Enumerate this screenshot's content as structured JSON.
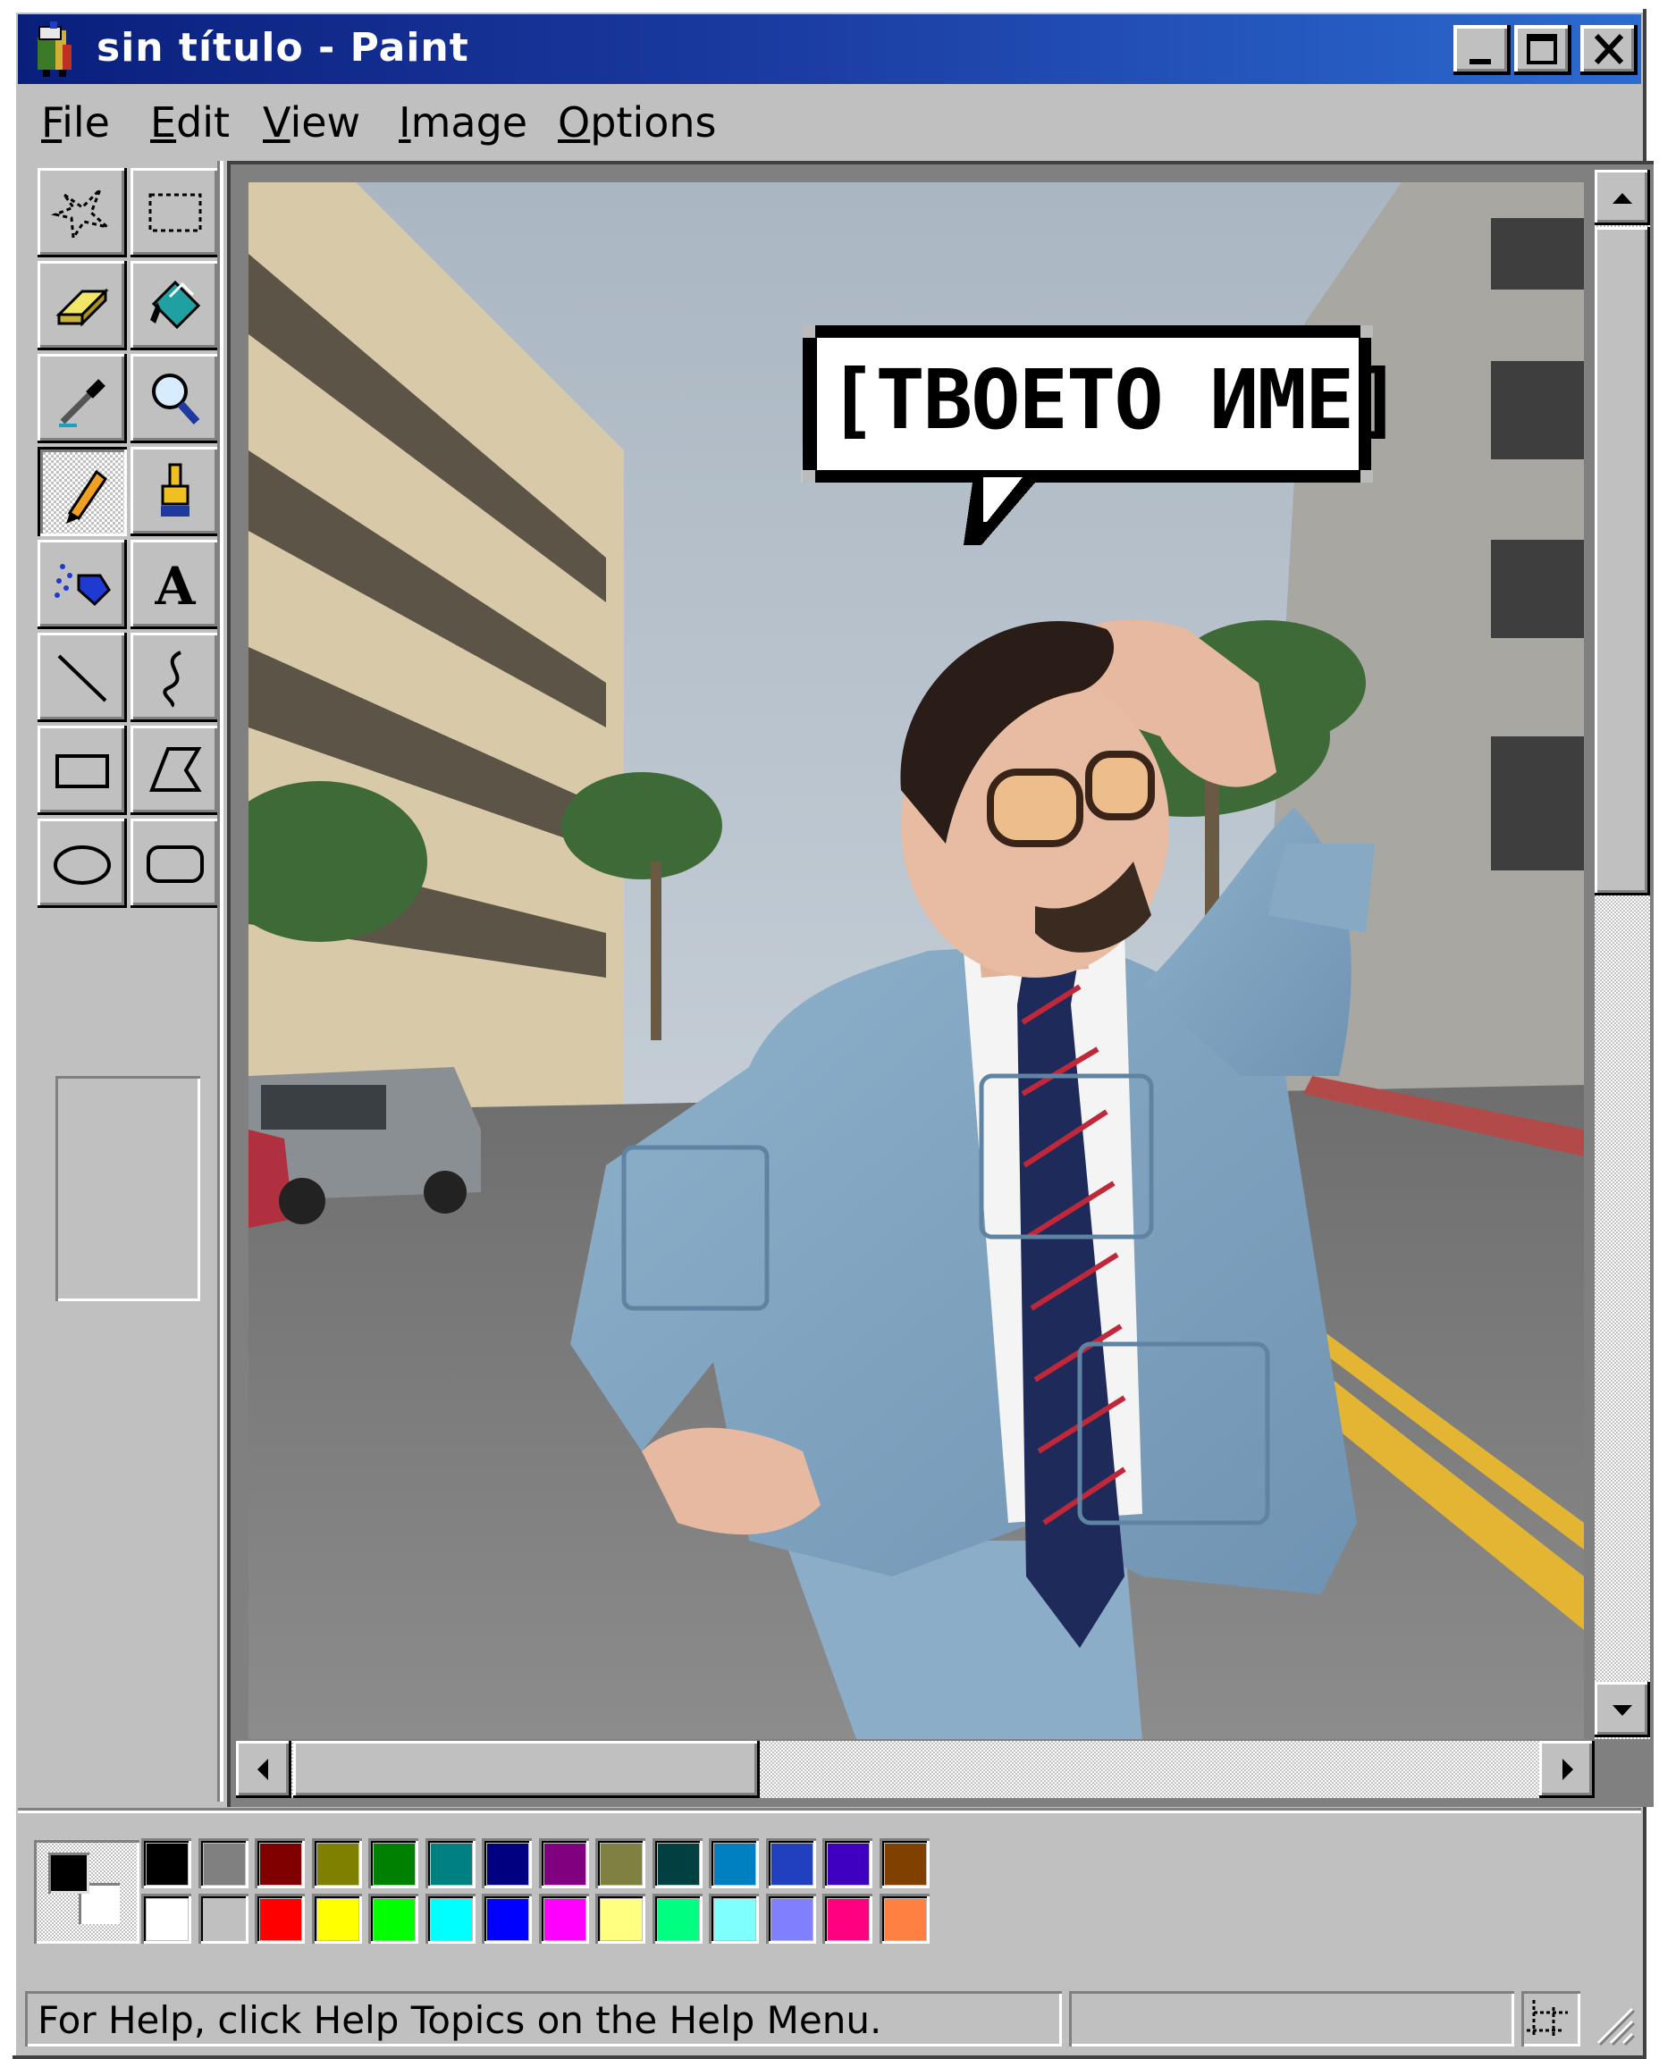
{
  "window": {
    "title": "sin título - Paint",
    "controls": [
      "minimize-icon",
      "maximize-icon",
      "close-icon"
    ]
  },
  "menu": {
    "items": [
      {
        "label": "File",
        "ul": "F",
        "rest": "ile"
      },
      {
        "label": "Edit",
        "ul": "E",
        "rest": "dit"
      },
      {
        "label": "View",
        "ul": "V",
        "rest": "iew"
      },
      {
        "label": "Image",
        "ul": "I",
        "rest": "mage"
      },
      {
        "label": "Options",
        "ul": "O",
        "rest": "ptions"
      }
    ]
  },
  "tools": [
    "free-form-select-icon",
    "rectangle-select-icon",
    "eraser-icon",
    "fill-bucket-icon",
    "color-picker-icon",
    "magnifier-icon",
    "pencil-icon",
    "brush-icon",
    "airbrush-icon",
    "text-icon",
    "line-icon",
    "curve-icon",
    "rectangle-icon",
    "polygon-icon",
    "ellipse-icon",
    "rounded-rectangle-icon"
  ],
  "active_tool": "pencil-icon",
  "canvas": {
    "speech_bubble_text": "[ТВОЕТО ИМЕ]"
  },
  "palette": {
    "foreground": "#000000",
    "background": "#ffffff",
    "top_row": [
      "#000000",
      "#808080",
      "#800000",
      "#808000",
      "#008000",
      "#008080",
      "#000080",
      "#800080",
      "#808040",
      "#004040",
      "#0080c0",
      "#2040c0",
      "#4000c0",
      "#804000"
    ],
    "bottom_row": [
      "#ffffff",
      "#c0c0c0",
      "#ff0000",
      "#ffff00",
      "#00ff00",
      "#00ffff",
      "#0000ff",
      "#ff00ff",
      "#ffff80",
      "#00ff80",
      "#80ffff",
      "#8080ff",
      "#ff0080",
      "#ff8040"
    ]
  },
  "status": {
    "help_text": "For Help, click Help Topics on the Help Menu."
  }
}
